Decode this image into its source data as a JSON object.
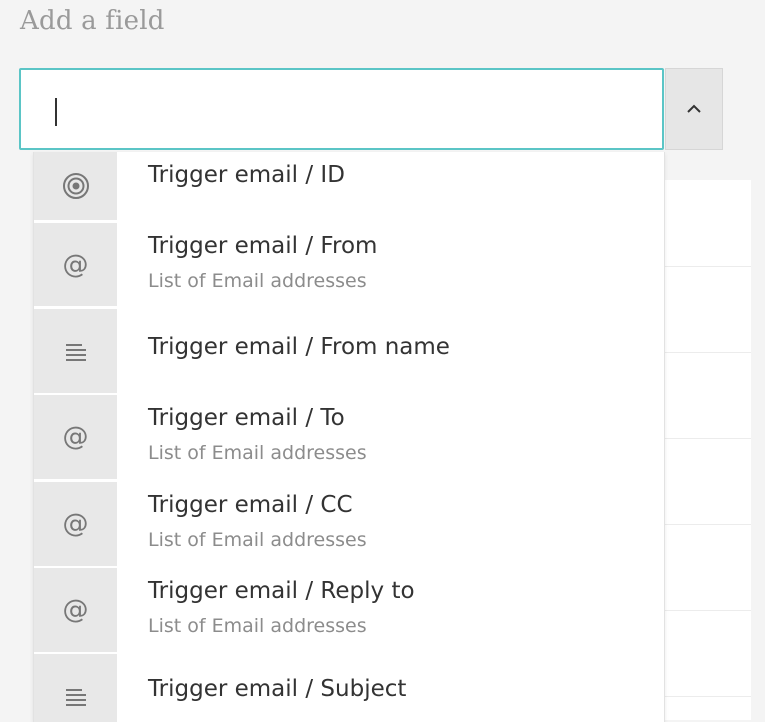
{
  "label": "Add a field",
  "input": {
    "value": ""
  },
  "options": [
    {
      "icon": "target-icon",
      "title": "Trigger email / ID",
      "subtitle": ""
    },
    {
      "icon": "at-icon",
      "title": "Trigger email / From",
      "subtitle": "List of Email addresses"
    },
    {
      "icon": "text-lines-icon",
      "title": "Trigger email / From name",
      "subtitle": ""
    },
    {
      "icon": "at-icon",
      "title": "Trigger email / To",
      "subtitle": "List of Email addresses"
    },
    {
      "icon": "at-icon",
      "title": "Trigger email / CC",
      "subtitle": "List of Email addresses"
    },
    {
      "icon": "at-icon",
      "title": "Trigger email / Reply to",
      "subtitle": "List of Email addresses"
    },
    {
      "icon": "text-lines-icon",
      "title": "Trigger email / Subject",
      "subtitle": ""
    }
  ],
  "colors": {
    "focus_border": "#5bc5c6",
    "icon_bg": "#e8e8e8",
    "icon": "#777777"
  }
}
